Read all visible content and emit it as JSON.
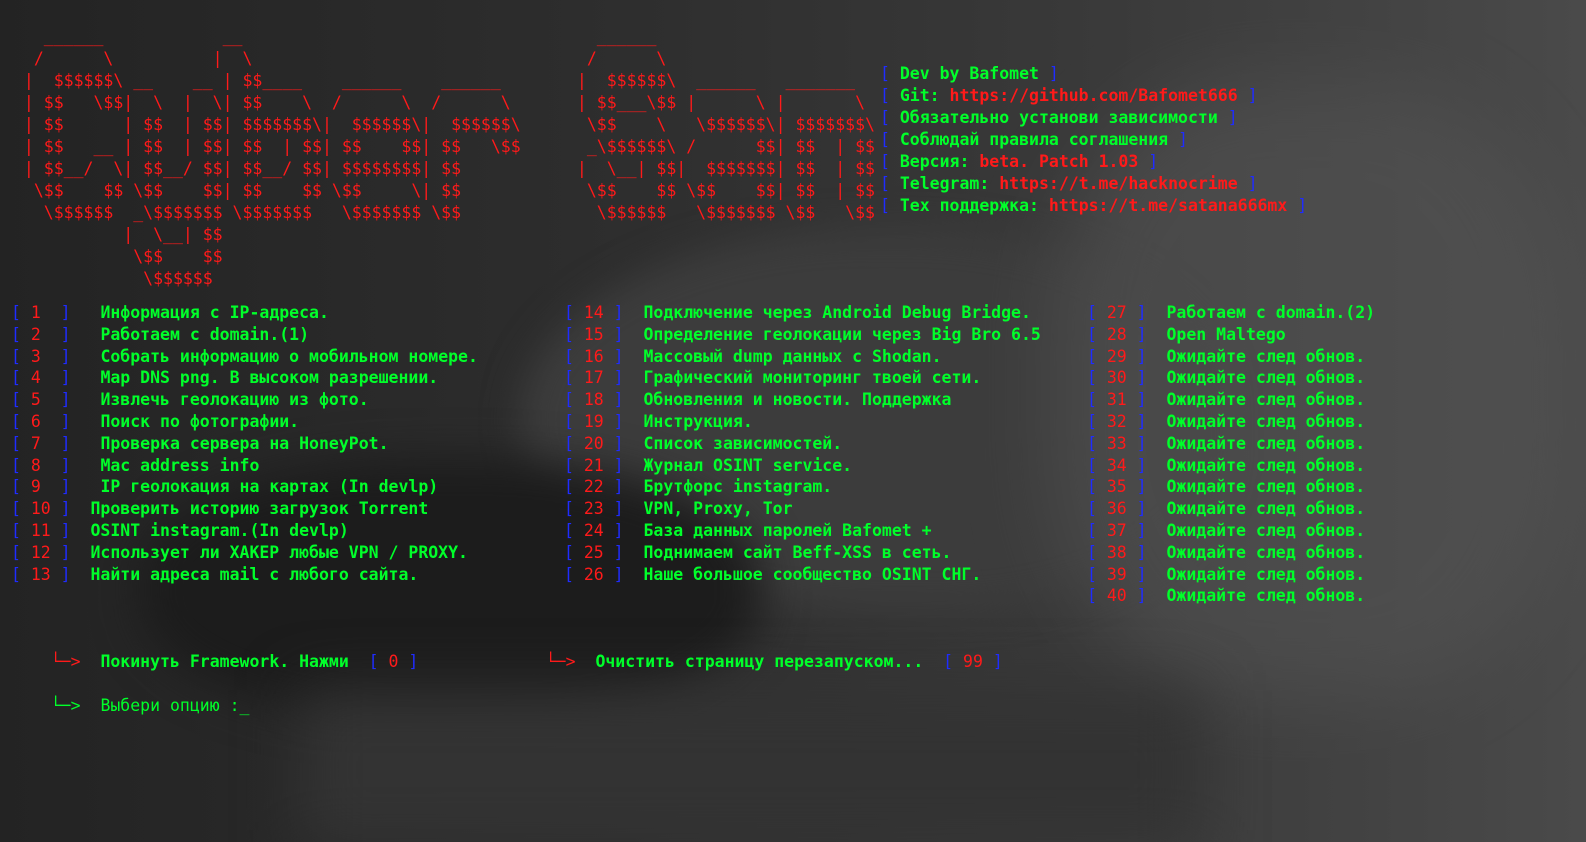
{
  "ascii_left": "   ______            __\n  /      \\          |  \\\n |  $$$$$$\\ __    __ | $$____    ______    ______\n | $$   \\$$|  \\  |  \\| $$    \\  /      \\  /      \\\n | $$      | $$  | $$| $$$$$$$\\|  $$$$$$\\|  $$$$$$\\\n | $$   __ | $$  | $$| $$  | $$| $$    $$| $$   \\$$\n | $$__/  \\| $$__/ $$| $$__/ $$| $$$$$$$$| $$\n  \\$$    $$ \\$$    $$| $$    $$ \\$$     \\| $$\n   \\$$$$$$  _\\$$$$$$$ \\$$$$$$$   \\$$$$$$$ \\$$\n           |  \\__| $$\n            \\$$    $$\n             \\$$$$$$",
  "ascii_right": "   ______\n  /      \\\n |  $$$$$$\\  ______   _______\n | $$___\\$$ |      \\ |       \\\n  \\$$    \\   \\$$$$$$\\| $$$$$$$\\\n  _\\$$$$$$\\ /      $$| $$  | $$\n |  \\__| $$|  $$$$$$$| $$  | $$\n  \\$$    $$ \\$$    $$| $$  | $$\n   \\$$$$$$   \\$$$$$$$ \\$$   \\$$",
  "info": [
    {
      "label": "Dev by Bafomet",
      "value": ""
    },
    {
      "label": "Git: ",
      "value": "https://github.com/Bafomet666"
    },
    {
      "label": "Обязательно установи зависимости",
      "value": ""
    },
    {
      "label": "Соблюдай правила соглашения",
      "value": ""
    },
    {
      "label": "Версия: ",
      "value": "beta. Patch 1.03"
    },
    {
      "label": "Telegram: ",
      "value": "https://t.me/hacknocrime"
    },
    {
      "label": "Тех поддержка: ",
      "value": "https://t.me/satana666mx"
    }
  ],
  "menu_col1": [
    {
      "num": "1",
      "text": "Информация с IP-адреса."
    },
    {
      "num": "2",
      "text": "Работаем с domain.(1)"
    },
    {
      "num": "3",
      "text": "Собрать информацию о мобильном номере."
    },
    {
      "num": "4",
      "text": "Map DNS png. В высоком разрешении."
    },
    {
      "num": "5",
      "text": "Извлечь геолокацию из фото."
    },
    {
      "num": "6",
      "text": "Поиск по фотографии."
    },
    {
      "num": "7",
      "text": "Проверка сервера на HoneyPot."
    },
    {
      "num": "8",
      "text": "Mac address info"
    },
    {
      "num": "9",
      "text": "IP геолокация на картах (In devlp)"
    },
    {
      "num": "10",
      "text": "Проверить историю загрузок Torrent"
    },
    {
      "num": "11",
      "text": "OSINT instagram.(In devlp)"
    },
    {
      "num": "12",
      "text": "Использует ли ХАКЕР любые VPN / PROXY."
    },
    {
      "num": "13",
      "text": "Найти адреса mail с любого сайта."
    }
  ],
  "menu_col2": [
    {
      "num": "14",
      "text": "Подключение через Android Debug Bridge."
    },
    {
      "num": "15",
      "text": "Определение геолокации через Big Bro 6.5"
    },
    {
      "num": "16",
      "text": "Массовый dump данных с Shodan."
    },
    {
      "num": "17",
      "text": "Графический мониторинг твоей сети."
    },
    {
      "num": "18",
      "text": "Обновления и новости. Поддержка"
    },
    {
      "num": "19",
      "text": "Инструкция."
    },
    {
      "num": "20",
      "text": "Список зависимостей."
    },
    {
      "num": "21",
      "text": "Журнал OSINT service."
    },
    {
      "num": "22",
      "text": "Брутфорс instagram."
    },
    {
      "num": "23",
      "text": "VPN, Proxy, Tor"
    },
    {
      "num": "24",
      "text": "База данных паролей Bafomet +"
    },
    {
      "num": "25",
      "text": "Поднимаем сайт Beff-XSS в сеть."
    },
    {
      "num": "26",
      "text": "Наше большое сообщество OSINT СНГ."
    }
  ],
  "menu_col3": [
    {
      "num": "27",
      "text": "Работаем с domain.(2)"
    },
    {
      "num": "28",
      "text": "Open Maltego"
    },
    {
      "num": "29",
      "text": "Ожидайте след обнов."
    },
    {
      "num": "30",
      "text": "Ожидайте след обнов."
    },
    {
      "num": "31",
      "text": "Ожидайте след обнов."
    },
    {
      "num": "32",
      "text": "Ожидайте след обнов."
    },
    {
      "num": "33",
      "text": "Ожидайте след обнов."
    },
    {
      "num": "34",
      "text": "Ожидайте след обнов."
    },
    {
      "num": "35",
      "text": "Ожидайте след обнов."
    },
    {
      "num": "36",
      "text": "Ожидайте след обнов."
    },
    {
      "num": "37",
      "text": "Ожидайте след обнов."
    },
    {
      "num": "38",
      "text": "Ожидайте след обнов."
    },
    {
      "num": "39",
      "text": "Ожидайте след обнов."
    },
    {
      "num": "40",
      "text": "Ожидайте след обнов."
    }
  ],
  "exit_prompt": {
    "arrow": "└─>",
    "text": "Покинуть Framework. Нажми",
    "num": "0"
  },
  "clear_prompt": {
    "arrow": "└─>",
    "text": "Очистить страницу перезапуском...",
    "num": "99"
  },
  "input_prompt": {
    "arrow": "└─>",
    "text": "Выбери опцию :",
    "cursor": "_"
  },
  "colors": {
    "red": "#ff1a1a",
    "green": "#00ff2a",
    "blue": "#1f2cff",
    "background": "#2a2a2a"
  }
}
